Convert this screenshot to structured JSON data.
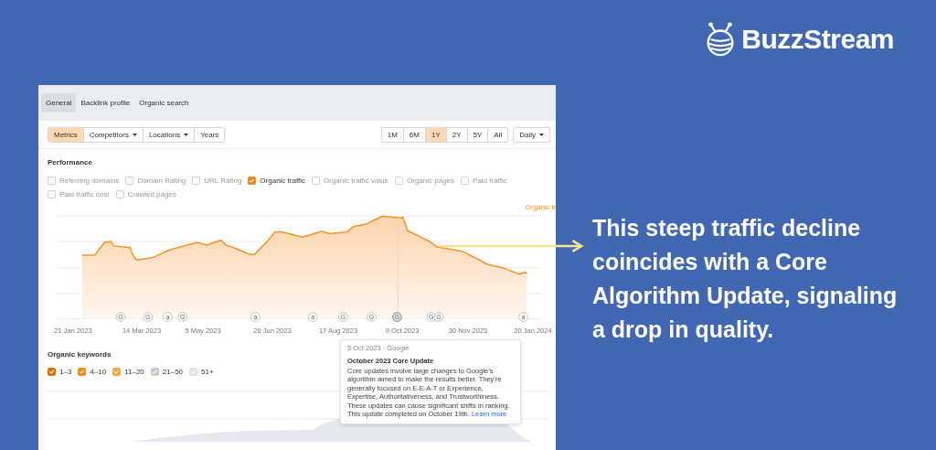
{
  "logo": {
    "text": "BuzzStream"
  },
  "panel": {
    "tabs": [
      {
        "label": "General",
        "selected": true
      },
      {
        "label": "Backlink profile",
        "selected": false
      },
      {
        "label": "Organic search",
        "selected": false
      }
    ],
    "filters": [
      {
        "label": "Metrics",
        "selected": true,
        "dropdown": false
      },
      {
        "label": "Competitors",
        "selected": false,
        "dropdown": true
      },
      {
        "label": "Locations",
        "selected": false,
        "dropdown": true
      },
      {
        "label": "Years",
        "selected": false,
        "dropdown": false
      }
    ],
    "ranges": [
      {
        "label": "1M",
        "selected": false
      },
      {
        "label": "6M",
        "selected": false
      },
      {
        "label": "1Y",
        "selected": true
      },
      {
        "label": "2Y",
        "selected": false
      },
      {
        "label": "5Y",
        "selected": false
      },
      {
        "label": "All",
        "selected": false
      }
    ],
    "interval": {
      "label": "Daily"
    },
    "performance": {
      "title": "Performance",
      "metrics": [
        {
          "label": "Referring domains",
          "checked": false
        },
        {
          "label": "Domain Rating",
          "checked": false
        },
        {
          "label": "URL Rating",
          "checked": false
        },
        {
          "label": "Organic traffic",
          "checked": true
        },
        {
          "label": "Organic traffic value",
          "checked": false
        },
        {
          "label": "Organic pages",
          "checked": false
        },
        {
          "label": "Paid traffic",
          "checked": false
        },
        {
          "label": "Paid traffic cost",
          "checked": false
        },
        {
          "label": "Crawled pages",
          "checked": false
        }
      ],
      "legend": "Organic tr",
      "x_labels": [
        "21 Jan 2023",
        "14 Mar 2023",
        "5 May 2023",
        "26 Jun 2023",
        "17 Aug 2023",
        "9 Oct 2023",
        "30 Nov 2023",
        "20 Jan 2024"
      ],
      "markers": [
        {
          "label": "G",
          "selected": false
        },
        {
          "label": "G",
          "selected": false
        },
        {
          "label": "a",
          "selected": false
        },
        {
          "label": "G",
          "selected": false
        },
        {
          "label": "a",
          "selected": false
        },
        {
          "label": "a",
          "selected": false
        },
        {
          "label": "G",
          "selected": false
        },
        {
          "label": "G",
          "selected": false
        },
        {
          "label": "G",
          "selected": true
        },
        {
          "label": "G",
          "selected": false
        },
        {
          "label": "G",
          "selected": false
        },
        {
          "label": "a",
          "selected": false
        }
      ]
    },
    "keywords": {
      "title": "Organic keywords",
      "ranges": [
        {
          "label": "1–3",
          "checked": true,
          "color": "#d9730d"
        },
        {
          "label": "4–10",
          "checked": true,
          "color": "#f08c1a"
        },
        {
          "label": "11–20",
          "checked": true,
          "color": "#f6a843"
        },
        {
          "label": "21–50",
          "checked": true,
          "color": "#c5cbd5"
        },
        {
          "label": "51+",
          "checked": true,
          "color": "#dfe2e8"
        }
      ]
    },
    "tooltip": {
      "meta": "5 Oct 2023 · Google",
      "title": "October 2023 Core Update",
      "body": "Core updates involve large changes to Google’s algorithm aimed to make the results better. They’re generally focused on E-E-A-T or Experience, Expertise, Authoritativeness, and Trustworthiness. These updates can cause significant shifts in ranking. This update completed on October 19th.",
      "link": "Learn more"
    }
  },
  "callout": "This steep traffic decline coincides with a Core Algorithm Update, signaling a drop in quality."
}
